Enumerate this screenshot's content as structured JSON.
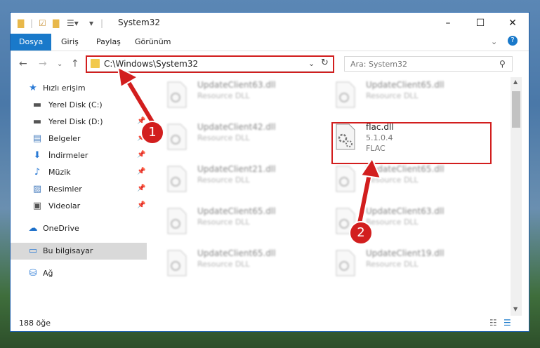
{
  "window": {
    "title": "System32"
  },
  "ribbon": {
    "tabs": [
      "Dosya",
      "Giriş",
      "Paylaş",
      "Görünüm"
    ]
  },
  "address": {
    "path": "C:\\Windows\\System32"
  },
  "search": {
    "placeholder": "Ara: System32"
  },
  "sidebar": {
    "items": [
      {
        "label": "Hızlı erişim"
      },
      {
        "label": "Yerel Disk (C:)"
      },
      {
        "label": "Yerel Disk (D:)"
      },
      {
        "label": "Belgeler"
      },
      {
        "label": "İndirmeler"
      },
      {
        "label": "Müzik"
      },
      {
        "label": "Resimler"
      },
      {
        "label": "Videolar"
      },
      {
        "label": "OneDrive"
      },
      {
        "label": "Bu bilgisayar"
      },
      {
        "label": "Ağ"
      }
    ]
  },
  "files": [
    {
      "name": "UpdateClient63.dll",
      "type": "Resource DLL"
    },
    {
      "name": "UpdateClient65.dll",
      "type": "Resource DLL"
    },
    {
      "name": "UpdateClient42.dll",
      "type": "Resource DLL"
    },
    {
      "name": "flac.dll",
      "version": "5.1.0.4",
      "company": "FLAC"
    },
    {
      "name": "UpdateClient21.dll",
      "type": "Resource DLL"
    },
    {
      "name": "UpdateClient65.dll",
      "type": "Resource DLL"
    },
    {
      "name": "UpdateClient65.dll",
      "type": "Resource DLL"
    },
    {
      "name": "UpdateClient63.dll",
      "type": "Resource DLL"
    },
    {
      "name": "UpdateClient65.dll",
      "type": "Resource DLL"
    },
    {
      "name": "UpdateClient19.dll",
      "type": "Resource DLL"
    }
  ],
  "status": {
    "count": "188 öğe"
  },
  "markers": {
    "one": "1",
    "two": "2"
  },
  "colors": {
    "accent": "#1979ca",
    "highlight": "#d21e1e"
  }
}
